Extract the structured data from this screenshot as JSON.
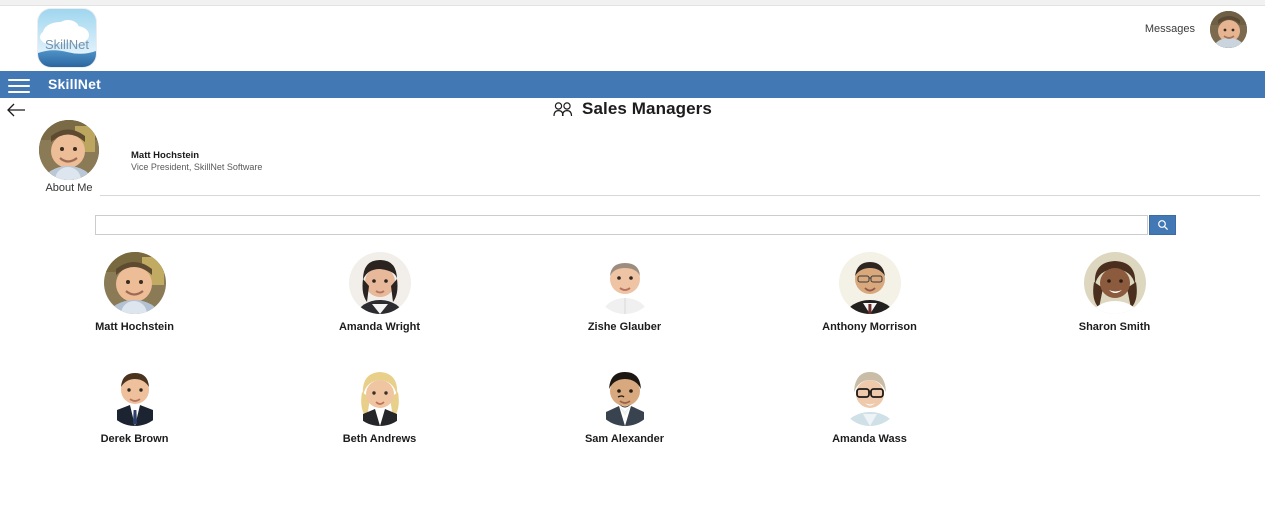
{
  "header": {
    "logo_text": "SkillNet",
    "messages_label": "Messages",
    "avatar_name": "user-avatar"
  },
  "navbar": {
    "brand": "SkillNet",
    "menu_icon": "hamburger-icon"
  },
  "page": {
    "back_icon": "back-arrow-icon",
    "title_icon": "people-group-icon",
    "title": "Sales Managers"
  },
  "profile": {
    "name": "Matt Hochstein",
    "role": "Vice President, SkillNet Software",
    "about_label": "About Me"
  },
  "search": {
    "value": "",
    "placeholder": "",
    "button_icon": "search-icon"
  },
  "people": [
    [
      {
        "name": "Matt Hochstein",
        "photo": "p-matt"
      },
      {
        "name": "Amanda Wright",
        "photo": "p-amanda-w"
      },
      {
        "name": "Zishe Glauber",
        "photo": "p-zishe"
      },
      {
        "name": "Anthony Morrison",
        "photo": "p-anthony"
      },
      {
        "name": "Sharon Smith",
        "photo": "p-sharon"
      }
    ],
    [
      {
        "name": "Derek Brown",
        "photo": "p-derek"
      },
      {
        "name": "Beth Andrews",
        "photo": "p-beth"
      },
      {
        "name": "Sam Alexander",
        "photo": "p-sam"
      },
      {
        "name": "Amanda Wass",
        "photo": "p-amandaw2"
      }
    ]
  ],
  "colors": {
    "navbar_blue": "#4278b4",
    "page_background": "#ffffff",
    "divider": "#d8d8d8",
    "text_dark": "#1c1c1c"
  }
}
